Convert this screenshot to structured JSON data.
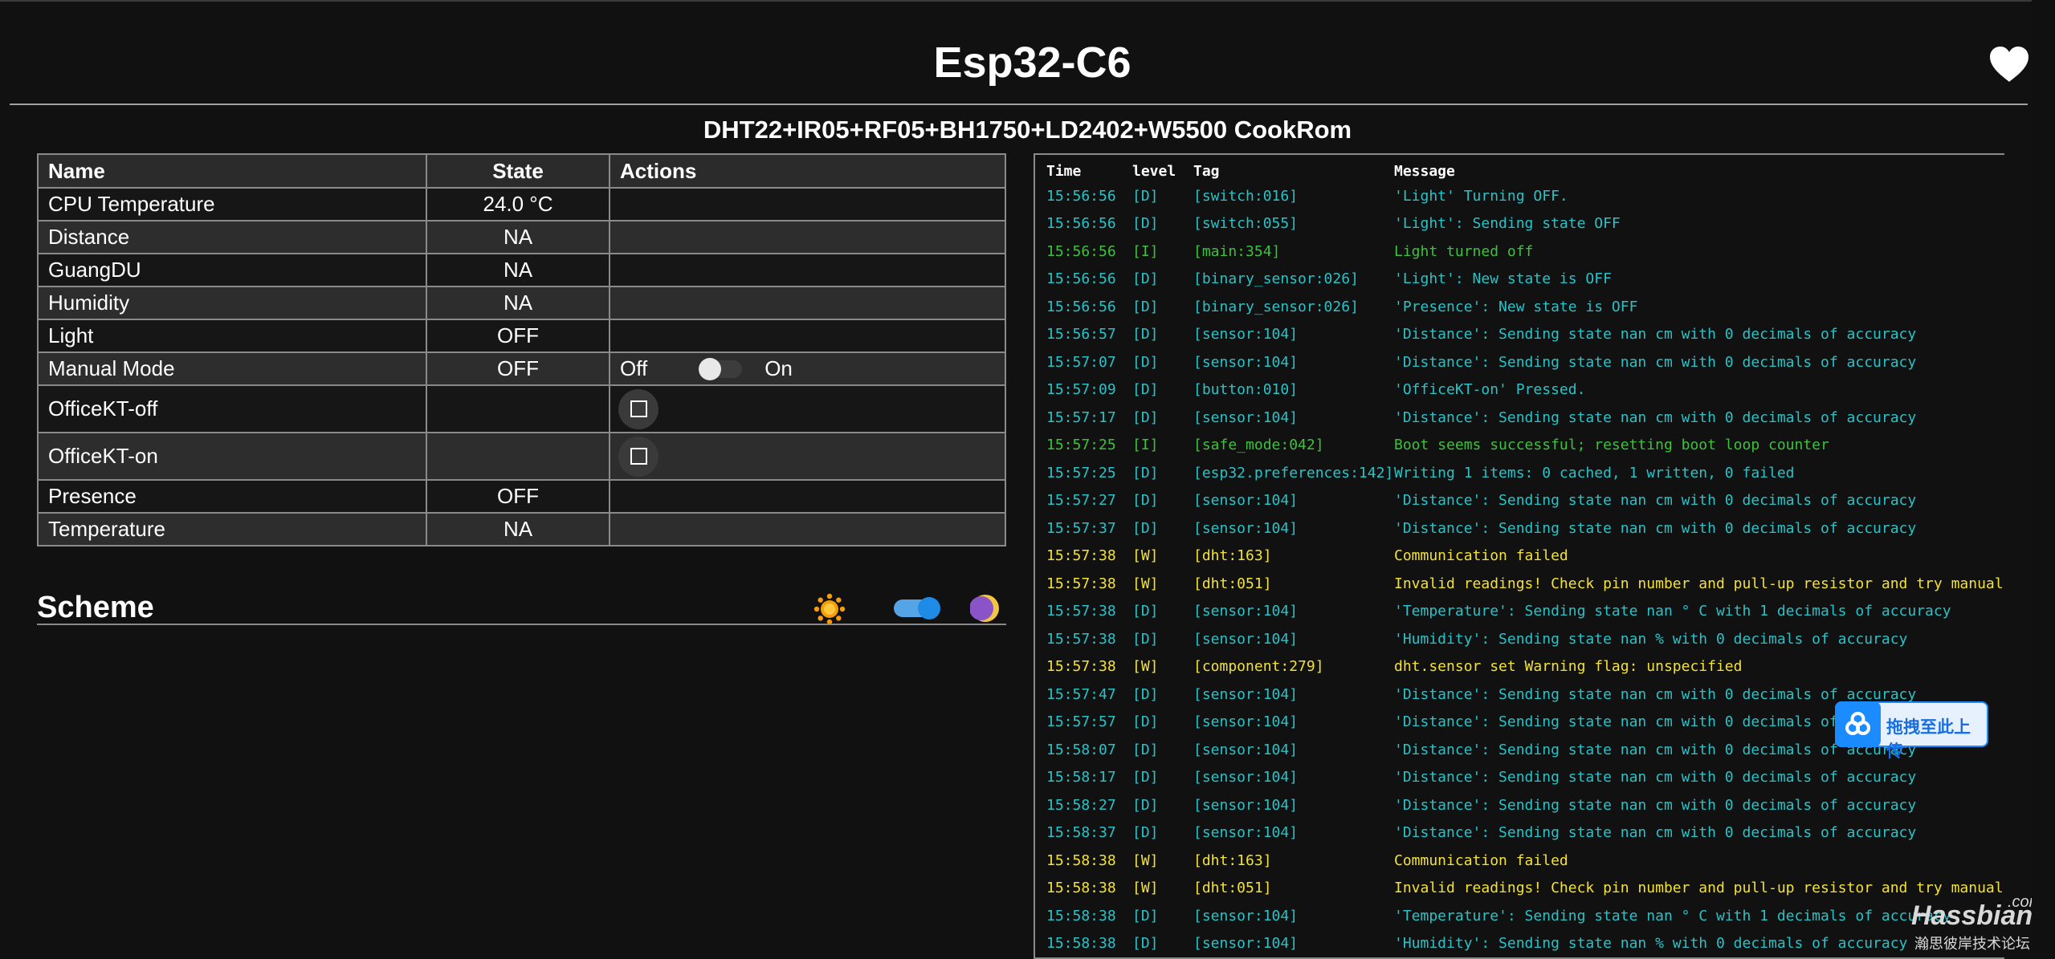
{
  "header": {
    "title": "Esp32-C6",
    "subtitle": "DHT22+IR05+RF05+BH1750+LD2402+W5500 CookRom"
  },
  "table": {
    "columns": [
      "Name",
      "State",
      "Actions"
    ],
    "rows": [
      {
        "name": "CPU Temperature",
        "state": "24.0 °C"
      },
      {
        "name": "Distance",
        "state": "NA"
      },
      {
        "name": "GuangDU",
        "state": "NA"
      },
      {
        "name": "Humidity",
        "state": "NA"
      },
      {
        "name": "Light",
        "state": "OFF"
      },
      {
        "name": "Manual Mode",
        "state": "OFF",
        "switch_off": "Off",
        "switch_on": "On",
        "switch_value": false
      },
      {
        "name": "OfficeKT-off",
        "state": ""
      },
      {
        "name": "OfficeKT-on",
        "state": ""
      },
      {
        "name": "Presence",
        "state": "OFF"
      },
      {
        "name": "Temperature",
        "state": "NA"
      }
    ]
  },
  "scheme": {
    "title": "Scheme",
    "dark_mode": true,
    "light_icon": "sun-icon",
    "dark_icon": "moon-icon"
  },
  "log": {
    "headers": {
      "time": "Time",
      "level": "level",
      "tag": "Tag",
      "message": "Message"
    },
    "colors": {
      "D": "#29c3c7",
      "I": "#3cc23c",
      "W": "#f2e233"
    },
    "rows": [
      {
        "time": "15:56:56",
        "level": "D",
        "tag": "[switch:016]",
        "message": "'Light' Turning OFF."
      },
      {
        "time": "15:56:56",
        "level": "D",
        "tag": "[switch:055]",
        "message": "'Light': Sending state OFF"
      },
      {
        "time": "15:56:56",
        "level": "I",
        "tag": "[main:354]",
        "message": "Light turned off"
      },
      {
        "time": "15:56:56",
        "level": "D",
        "tag": "[binary_sensor:026]",
        "message": "'Light': New state is OFF"
      },
      {
        "time": "15:56:56",
        "level": "D",
        "tag": "[binary_sensor:026]",
        "message": "'Presence': New state is OFF"
      },
      {
        "time": "15:56:57",
        "level": "D",
        "tag": "[sensor:104]",
        "message": "'Distance': Sending state nan cm with 0 decimals of accuracy"
      },
      {
        "time": "15:57:07",
        "level": "D",
        "tag": "[sensor:104]",
        "message": "'Distance': Sending state nan cm with 0 decimals of accuracy"
      },
      {
        "time": "15:57:09",
        "level": "D",
        "tag": "[button:010]",
        "message": "'OfficeKT-on' Pressed."
      },
      {
        "time": "15:57:17",
        "level": "D",
        "tag": "[sensor:104]",
        "message": "'Distance': Sending state nan cm with 0 decimals of accuracy"
      },
      {
        "time": "15:57:25",
        "level": "I",
        "tag": "[safe_mode:042]",
        "message": "Boot seems successful; resetting boot loop counter"
      },
      {
        "time": "15:57:25",
        "level": "D",
        "tag": "[esp32.preferences:142]",
        "message": "Writing 1 items: 0 cached, 1 written, 0 failed"
      },
      {
        "time": "15:57:27",
        "level": "D",
        "tag": "[sensor:104]",
        "message": "'Distance': Sending state nan cm with 0 decimals of accuracy"
      },
      {
        "time": "15:57:37",
        "level": "D",
        "tag": "[sensor:104]",
        "message": "'Distance': Sending state nan cm with 0 decimals of accuracy"
      },
      {
        "time": "15:57:38",
        "level": "W",
        "tag": "[dht:163]",
        "message": "Communication failed"
      },
      {
        "time": "15:57:38",
        "level": "W",
        "tag": "[dht:051]",
        "message": "Invalid readings! Check pin number and pull-up resistor and try manually speci"
      },
      {
        "time": "15:57:38",
        "level": "D",
        "tag": "[sensor:104]",
        "message": "'Temperature': Sending state nan ° C with 1 decimals of accuracy"
      },
      {
        "time": "15:57:38",
        "level": "D",
        "tag": "[sensor:104]",
        "message": "'Humidity': Sending state nan % with 0 decimals of accuracy"
      },
      {
        "time": "15:57:38",
        "level": "W",
        "tag": "[component:279]",
        "message": "dht.sensor set Warning flag: unspecified"
      },
      {
        "time": "15:57:47",
        "level": "D",
        "tag": "[sensor:104]",
        "message": "'Distance': Sending state nan cm with 0 decimals of accuracy"
      },
      {
        "time": "15:57:57",
        "level": "D",
        "tag": "[sensor:104]",
        "message": "'Distance': Sending state nan cm with 0 decimals of accuracy"
      },
      {
        "time": "15:58:07",
        "level": "D",
        "tag": "[sensor:104]",
        "message": "'Distance': Sending state nan cm with 0 decimals of accuracy"
      },
      {
        "time": "15:58:17",
        "level": "D",
        "tag": "[sensor:104]",
        "message": "'Distance': Sending state nan cm with 0 decimals of accuracy"
      },
      {
        "time": "15:58:27",
        "level": "D",
        "tag": "[sensor:104]",
        "message": "'Distance': Sending state nan cm with 0 decimals of accuracy"
      },
      {
        "time": "15:58:37",
        "level": "D",
        "tag": "[sensor:104]",
        "message": "'Distance': Sending state nan cm with 0 decimals of accuracy"
      },
      {
        "time": "15:58:38",
        "level": "W",
        "tag": "[dht:163]",
        "message": "Communication failed"
      },
      {
        "time": "15:58:38",
        "level": "W",
        "tag": "[dht:051]",
        "message": "Invalid readings! Check pin number and pull-up resistor and try manually speci"
      },
      {
        "time": "15:58:38",
        "level": "D",
        "tag": "[sensor:104]",
        "message": "'Temperature': Sending state nan ° C with 1 decimals of accuracy"
      },
      {
        "time": "15:58:38",
        "level": "D",
        "tag": "[sensor:104]",
        "message": "'Humidity': Sending state nan % with 0 decimals of accuracy"
      }
    ]
  },
  "overlay": {
    "upload_label": "拖拽至此上传",
    "upload_icon": "cloud-upload-icon"
  },
  "watermark": {
    "brand": "Hassbian",
    "domain": ".com",
    "tagline": "瀚思彼岸技术论坛"
  }
}
